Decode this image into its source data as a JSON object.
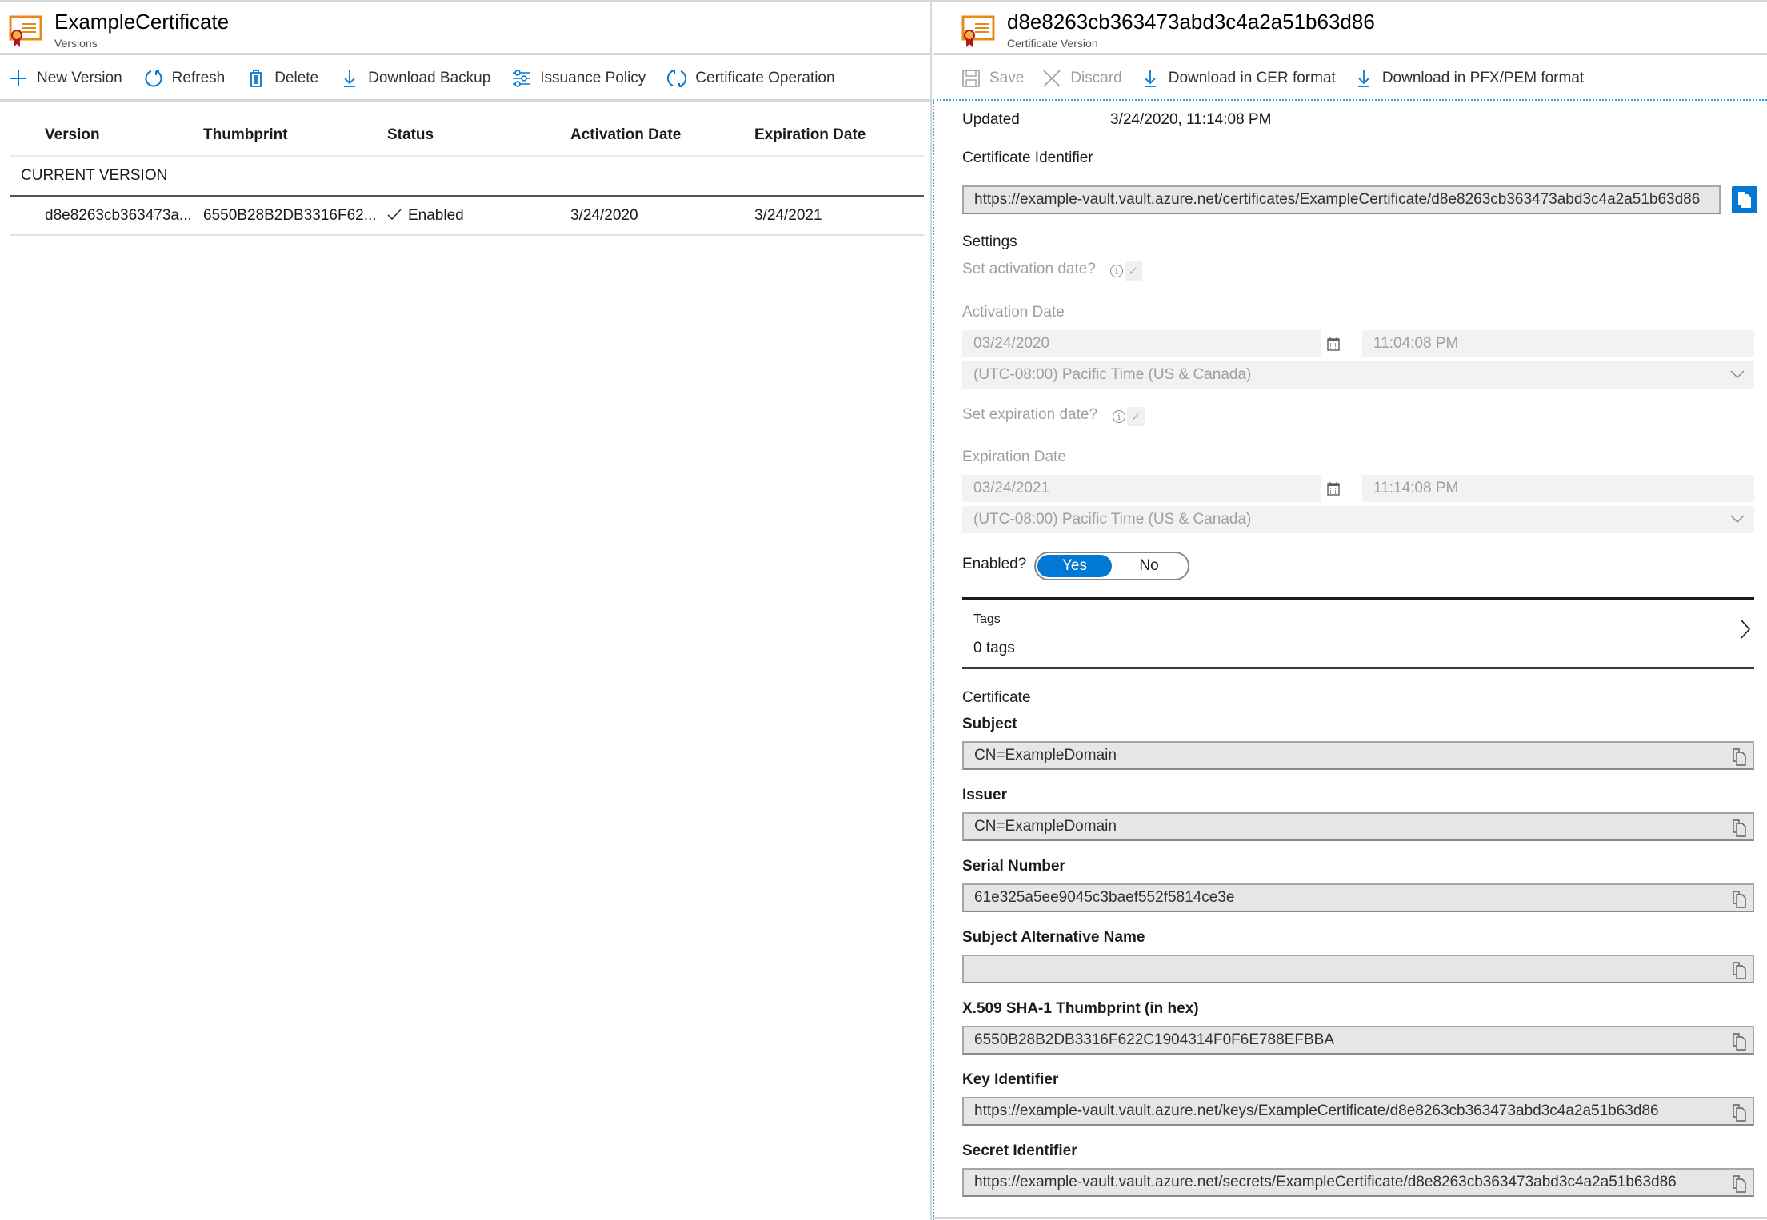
{
  "left": {
    "title": "ExampleCertificate",
    "subtitle": "Versions",
    "toolbar": [
      {
        "label": "New Version",
        "icon": "plus-icon"
      },
      {
        "label": "Refresh",
        "icon": "refresh-icon"
      },
      {
        "label": "Delete",
        "icon": "trash-icon"
      },
      {
        "label": "Download Backup",
        "icon": "download-icon"
      },
      {
        "label": "Issuance Policy",
        "icon": "sliders-icon"
      },
      {
        "label": "Certificate Operation",
        "icon": "sync-icon"
      }
    ],
    "table": {
      "columns": [
        "Version",
        "Thumbprint",
        "Status",
        "Activation Date",
        "Expiration Date"
      ],
      "group_label": "CURRENT VERSION",
      "rows": [
        {
          "version": "d8e8263cb363473a...",
          "thumbprint": "6550B28B2DB3316F62...",
          "status": "Enabled",
          "activation": "3/24/2020",
          "expiration": "3/24/2021"
        }
      ]
    }
  },
  "right": {
    "title": "d8e8263cb363473abd3c4a2a51b63d86",
    "subtitle": "Certificate Version",
    "toolbar": [
      {
        "label": "Save",
        "icon": "save-icon",
        "disabled": true
      },
      {
        "label": "Discard",
        "icon": "discard-icon",
        "disabled": true
      },
      {
        "label": "Download in CER format",
        "icon": "download-icon"
      },
      {
        "label": "Download in PFX/PEM format",
        "icon": "download-icon"
      }
    ],
    "updated_label": "Updated",
    "updated_value": "3/24/2020, 11:14:08 PM",
    "cert_id_label": "Certificate Identifier",
    "cert_id_value": "https://example-vault.vault.azure.net/certificates/ExampleCertificate/d8e8263cb363473abd3c4a2a51b63d86",
    "settings_label": "Settings",
    "set_activation_label": "Set activation date?",
    "activation": {
      "label": "Activation Date",
      "date": "03/24/2020",
      "time": "11:04:08 PM",
      "timezone": "(UTC-08:00) Pacific Time (US & Canada)"
    },
    "set_expiration_label": "Set expiration date?",
    "expiration": {
      "label": "Expiration Date",
      "date": "03/24/2021",
      "time": "11:14:08 PM",
      "timezone": "(UTC-08:00) Pacific Time (US & Canada)"
    },
    "enabled_label": "Enabled?",
    "enabled_yes": "Yes",
    "enabled_no": "No",
    "enabled_value": "Yes",
    "tags_label": "Tags",
    "tags_value": "0 tags",
    "certificate_label": "Certificate",
    "fields": [
      {
        "label": "Subject",
        "value": "CN=ExampleDomain"
      },
      {
        "label": "Issuer",
        "value": "CN=ExampleDomain"
      },
      {
        "label": "Serial Number",
        "value": "61e325a5ee9045c3baef552f5814ce3e"
      },
      {
        "label": "Subject Alternative Name",
        "value": ""
      },
      {
        "label": "X.509 SHA-1 Thumbprint (in hex)",
        "value": "6550B28B2DB3316F622C1904314F0F6E788EFBBA"
      },
      {
        "label": "Key Identifier",
        "value": "https://example-vault.vault.azure.net/keys/ExampleCertificate/d8e8263cb363473abd3c4a2a51b63d86"
      },
      {
        "label": "Secret Identifier",
        "value": "https://example-vault.vault.azure.net/secrets/ExampleCertificate/d8e8263cb363473abd3c4a2a51b63d86"
      }
    ]
  },
  "colors": {
    "accent": "#0078d4",
    "cert_orange": "#e8891c",
    "ribbon_red": "#b4161b",
    "focus_dotted": "#2ea8d8"
  }
}
